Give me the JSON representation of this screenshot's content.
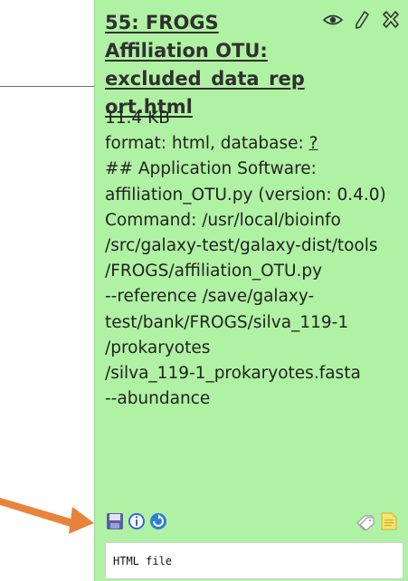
{
  "dataset": {
    "title": "55: FROGS Affiliation OTU: excluded_data_report.html",
    "size": "11.4 KB",
    "format_prefix": "format: html, database: ",
    "database": "?",
    "info_lines": [
      "## Application Software:",
      "affiliation_OTU.py (version: 0.4.0)",
      "Command: /usr/local/bioinfo",
      "/src/galaxy-test/galaxy-dist/tools",
      "/FROGS/affiliation_OTU.py",
      "--reference /save/galaxy-",
      "test/bank/FROGS/silva_119-1",
      "/prokaryotes",
      "/silva_119-1_prokaryotes.fasta",
      "--abundance"
    ],
    "peek": "HTML file"
  },
  "icons": {
    "view": "eye-icon",
    "edit": "pencil-icon",
    "delete": "delete-x-icon",
    "save": "floppy-disk-icon",
    "info": "info-icon",
    "rerun": "rerun-icon",
    "tags": "tags-icon",
    "annotate": "note-icon"
  },
  "colors": {
    "panel_background": "#b0f2a3",
    "accent_orange": "#e8833a"
  }
}
